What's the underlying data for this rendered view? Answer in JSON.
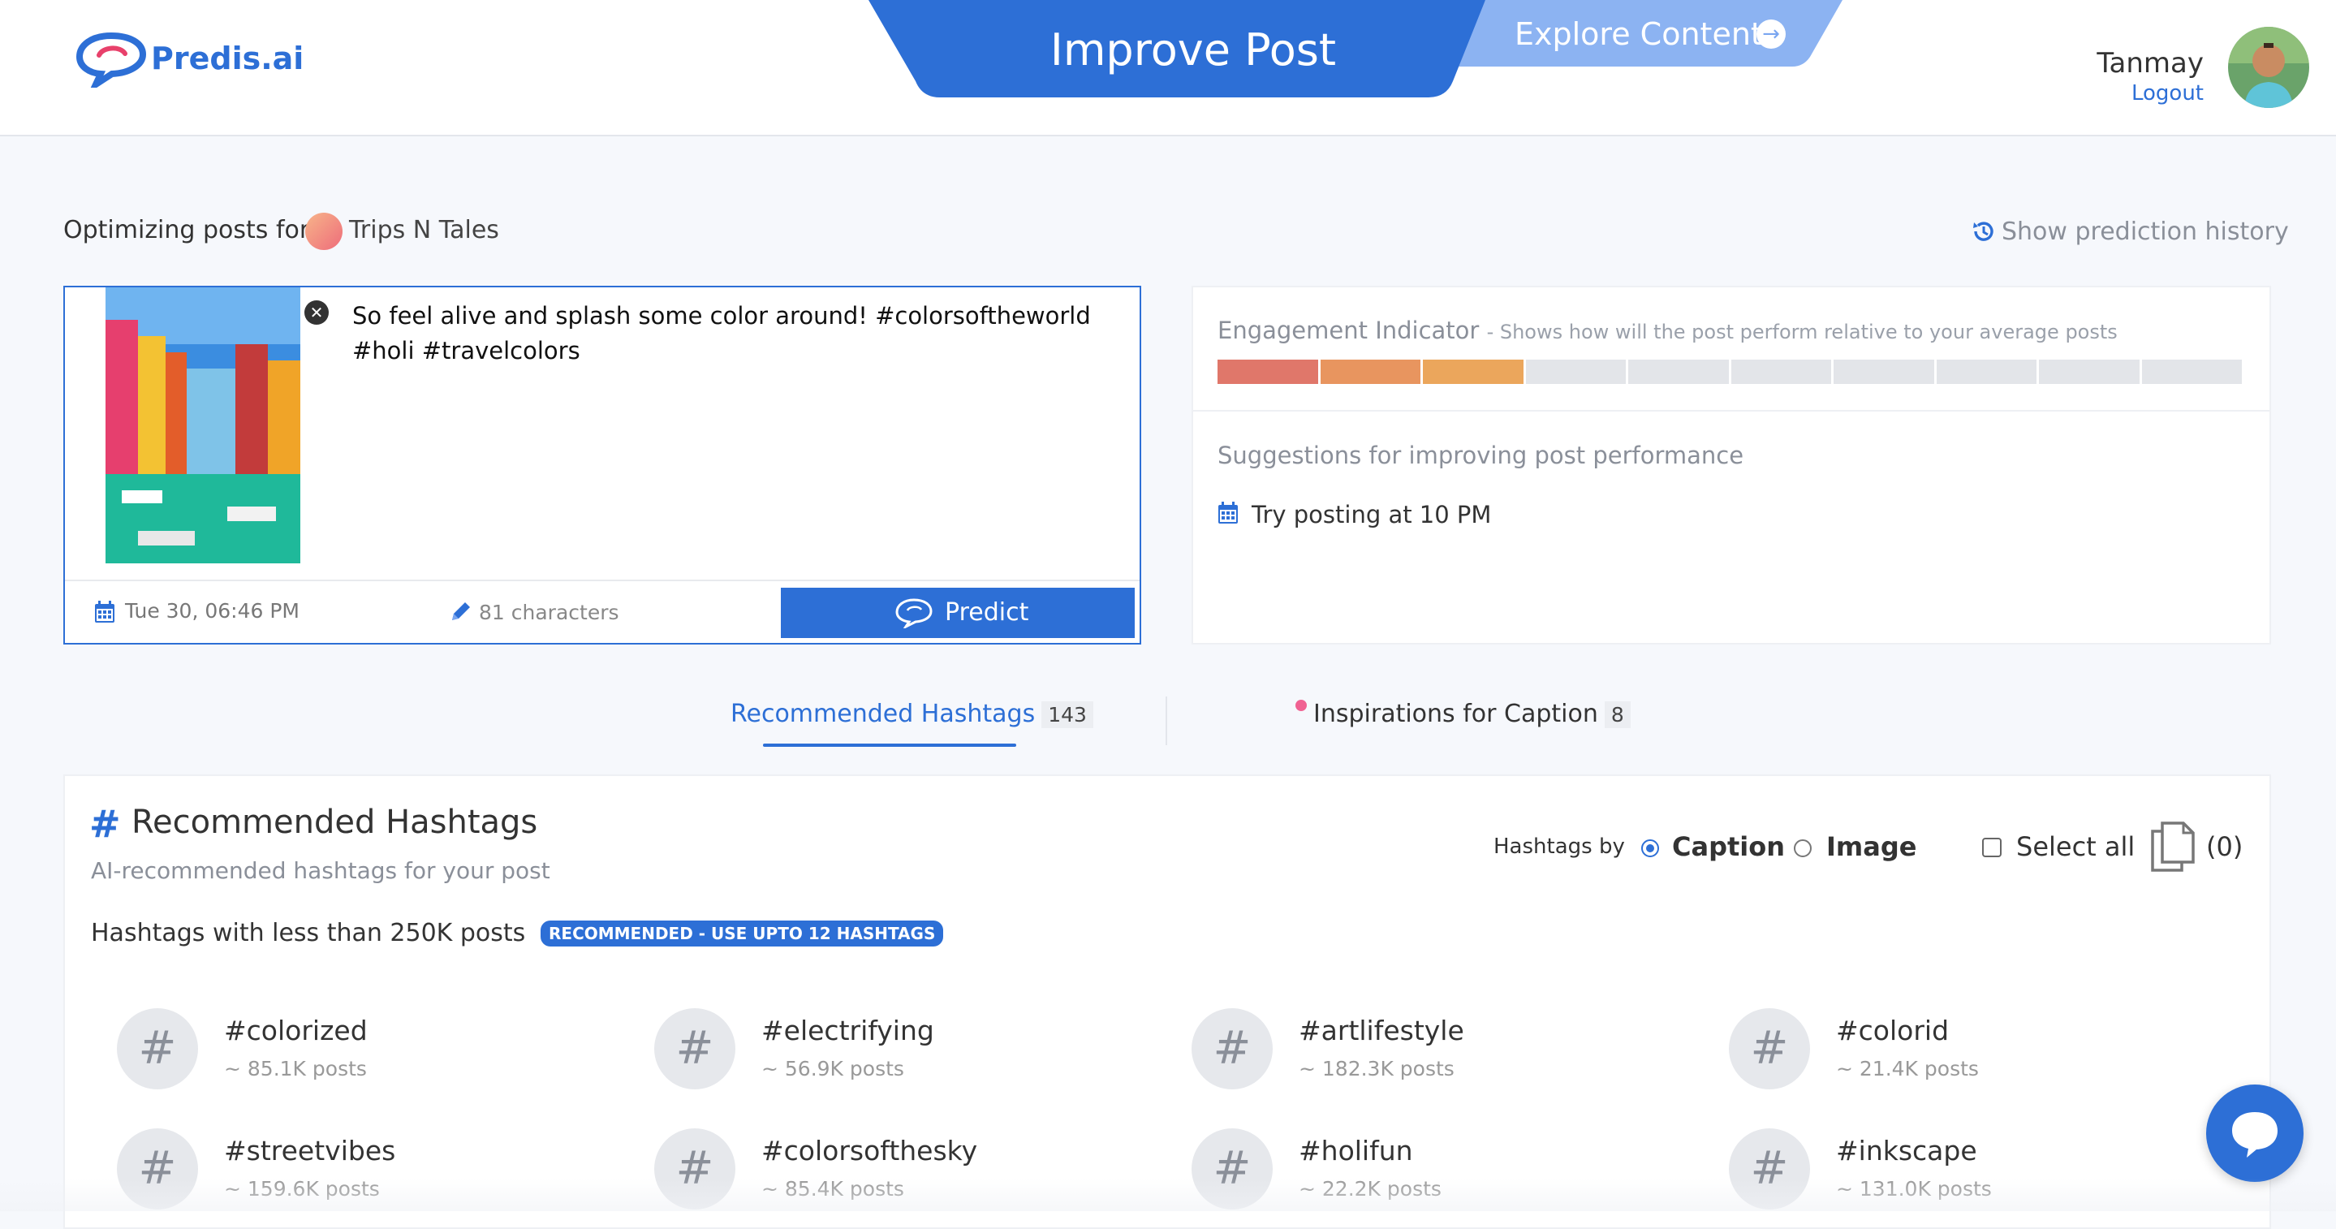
{
  "header": {
    "brand": "Predis.ai",
    "nav_improve": "Improve Post",
    "nav_explore": "Explore Content",
    "user_name": "Tanmay",
    "logout": "Logout",
    "colors": {
      "primary": "#2d6fd6",
      "explore_tab": "#8cb3f2"
    }
  },
  "optimizing": {
    "label": "Optimizing posts for",
    "account": "Trips N Tales",
    "history_link": "Show prediction history"
  },
  "post": {
    "caption": "So feel alive and splash some color around! #colorsoftheworld #holi #travelcolors",
    "date": "Tue 30, 06:46 PM",
    "char_count": "81 characters",
    "predict_label": "Predict"
  },
  "engagement": {
    "title": "Engagement Indicator",
    "subtitle": "- Shows how will the post perform relative to your average posts",
    "level": 3,
    "segments": 10,
    "segment_colors": [
      "#e0776a",
      "#e8955f",
      "#eba65c",
      "#e3e5e9"
    ],
    "suggestions_title": "Suggestions for improving post performance",
    "suggestion": "Try posting at 10 PM"
  },
  "tabs": {
    "hashtags_label": "Recommended Hashtags",
    "hashtags_count": "143",
    "inspirations_label": "Inspirations for Caption",
    "inspirations_count": "8"
  },
  "hashtags": {
    "title": "Recommended Hashtags",
    "subtitle": "AI-recommended hashtags for your post",
    "filter_label": "Hashtags with less than 250K posts",
    "badge": "RECOMMENDED - USE UPTO 12 HASHTAGS",
    "hashtags_by": "Hashtags by",
    "option_caption": "Caption",
    "option_image": "Image",
    "select_all": "Select all",
    "copy_count": "(0)",
    "items": [
      {
        "tag": "#colorized",
        "count": "~ 85.1K posts"
      },
      {
        "tag": "#electrifying",
        "count": "~ 56.9K posts"
      },
      {
        "tag": "#artlifestyle",
        "count": "~ 182.3K posts"
      },
      {
        "tag": "#colorid",
        "count": "~ 21.4K posts"
      },
      {
        "tag": "#streetvibes",
        "count": "~ 159.6K posts"
      },
      {
        "tag": "#colorsofthesky",
        "count": "~ 85.4K posts"
      },
      {
        "tag": "#holifun",
        "count": "~ 22.2K posts"
      },
      {
        "tag": "#inkscape",
        "count": "~ 131.0K posts"
      }
    ]
  }
}
